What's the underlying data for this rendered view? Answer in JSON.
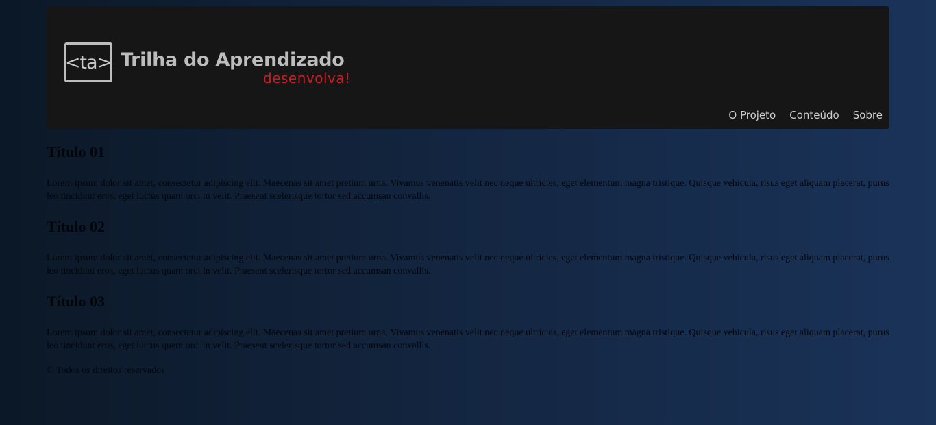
{
  "header": {
    "logo_box_text": "<ta>",
    "logo_title": "Trilha do Aprendizado",
    "logo_tagline": "desenvolva!",
    "nav": [
      {
        "label": "O Projeto"
      },
      {
        "label": "Conteúdo"
      },
      {
        "label": "Sobre"
      }
    ]
  },
  "sections": [
    {
      "title": "Título 01",
      "body": "Lorem ipsum dolor sit amet, consectetur adipiscing elit. Maecenas sit amet pretium urna. Vivamus venenatis velit nec neque ultricies, eget elementum magna tristique. Quisque vehicula, risus eget aliquam placerat, purus leo tincidunt eros, eget luctus quam orci in velit. Praesent scelerisque tortor sed accumsan convallis."
    },
    {
      "title": "Título 02",
      "body": "Lorem ipsum dolor sit amet, consectetur adipiscing elit. Maecenas sit amet pretium urna. Vivamus venenatis velit nec neque ultricies, eget elementum magna tristique. Quisque vehicula, risus eget aliquam placerat, purus leo tincidunt eros, eget luctus quam orci in velit. Praesent scelerisque tortor sed accumsan convallis."
    },
    {
      "title": "Título 03",
      "body": "Lorem ipsum dolor sit amet, consectetur adipiscing elit. Maecenas sit amet pretium urna. Vivamus venenatis velit nec neque ultricies, eget elementum magna tristique. Quisque vehicula, risus eget aliquam placerat, purus leo tincidunt eros, eget luctus quam orci in velit. Praesent scelerisque tortor sed accumsan convallis."
    }
  ],
  "footer": {
    "text": "© Todos os direitos reservados"
  },
  "colors": {
    "header_bg": "#161616",
    "logo_gray": "#bdbdbd",
    "tagline_red": "#c62025",
    "nav_text": "#d0d0d0",
    "bg_left": "#0b1827",
    "bg_right": "#1a3359"
  }
}
